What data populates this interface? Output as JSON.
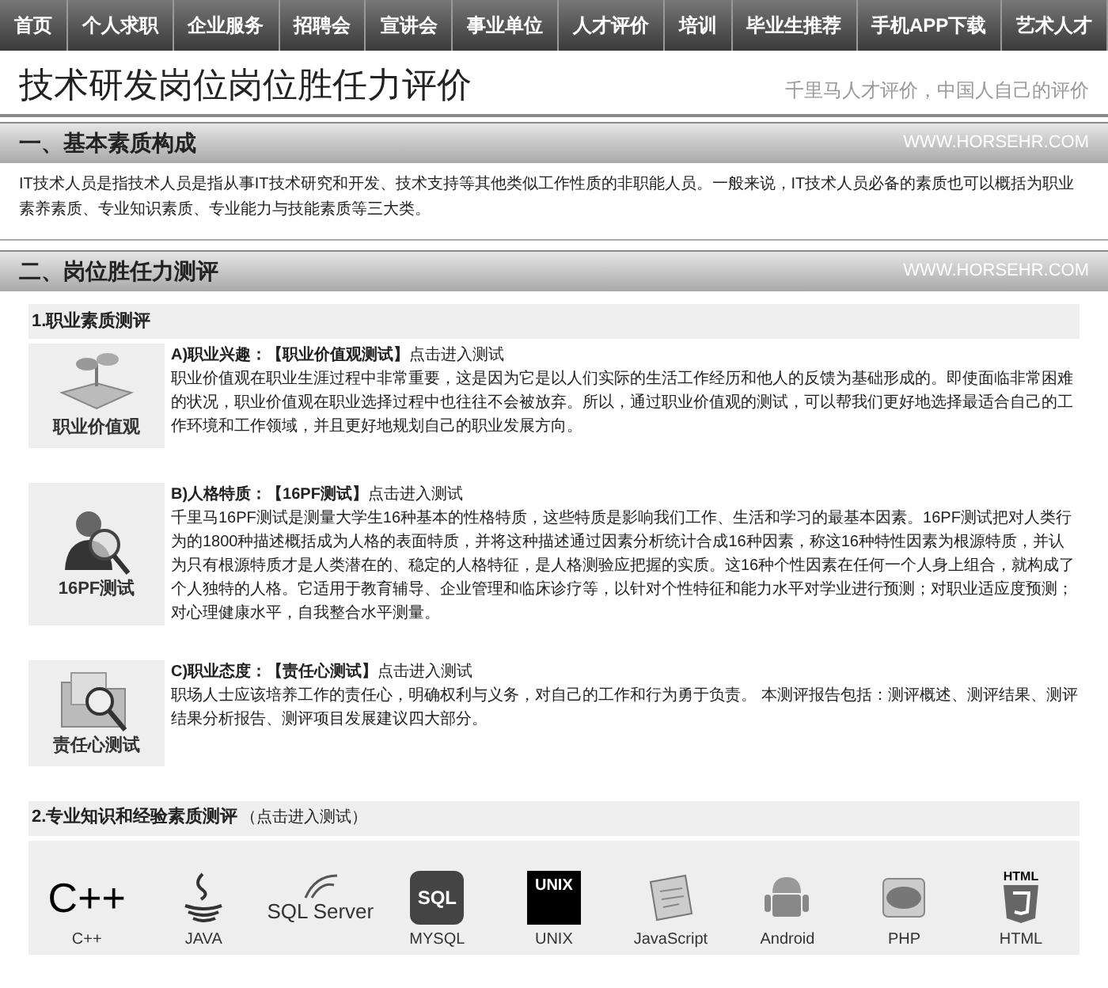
{
  "nav": [
    "首页",
    "个人求职",
    "企业服务",
    "招聘会",
    "宣讲会",
    "事业单位",
    "人才评价",
    "培训",
    "毕业生推荐",
    "手机APP下载",
    "艺术人才"
  ],
  "header": {
    "title": "技术研发岗位岗位胜任力评价",
    "slogan": "千里马人才评价，中国人自己的评价"
  },
  "sections": [
    {
      "title": "一、基本素质构成",
      "site": "WWW.HORSEHR.COM",
      "paragraph": "IT技术人员是指技术人员是指从事IT技术研究和开发、技术支持等其他类似工作性质的非职能人员。一般来说，IT技术人员必备的素质也可以概括为职业素养素质、专业知识素质、专业能力与技能素质等三大类。"
    },
    {
      "title": "二、岗位胜任力测评",
      "site": "WWW.HORSEHR.COM",
      "subsections": [
        {
          "title": "1.职业素质测评",
          "tests": [
            {
              "kind": "plant",
              "caption": "职业价值观",
              "heading": "**A)职业兴趣：【职业价值观测试】**点击进入测试",
              "text": "职业价值观在职业生涯过程中非常重要，这是因为它是以人们实际的生活工作经历和他人的反馈为基础形成的。即使面临非常困难的状况，职业价值观在职业选择过程中也往往不会被放弃。所以，通过职业价值观的测试，可以帮我们更好地选择最适合自己的工作环境和工作领域，并且更好地规划自己的职业发展方向。"
            },
            {
              "kind": "person",
              "caption": "16PF测试",
              "heading": "**B)人格特质：【16PF测试】**点击进入测试",
              "text": "千里马16PF测试是测量大学生16种基本的性格特质，这些特质是影响我们工作、生活和学习的最基本因素。16PF测试把对人类行为的1800种描述概括成为人格的表面特质，并将这种描述通过因素分析统计合成16种因素，称这16种特性因素为根源特质，并认为只有根源特质才是人类潜在的、稳定的人格特征，是人格测验应把握的实质。这16种个性因素在任何一个人身上组合，就构成了个人独特的人格。它适用于教育辅导、企业管理和临床诊疗等，以针对个性特征和能力水平对学业进行预测；对职业适应度预测；对心理健康水平，自我整合水平测量。"
            },
            {
              "kind": "folder",
              "caption": "责任心测试",
              "heading": "**C)职业态度：【责任心测试】**点击进入测试",
              "text": "职场人士应该培养工作的责任心，明确权利与义务，对自己的工作和行为勇于负责。 本测评报告包括：测评概述、测评结果、测评结果分析报告、测评项目发展建议四大部分。"
            }
          ]
        },
        {
          "title": "2.专业知识和经验素质测评",
          "note": "（点击进入测试）",
          "logos": [
            {
              "kind": "cpp",
              "logo_text": "C++",
              "label": "C++"
            },
            {
              "kind": "java",
              "label": "JAVA"
            },
            {
              "kind": "sqlserver",
              "logo_text": "SQL Server"
            },
            {
              "kind": "mysql",
              "logo_text": "SQL",
              "label": "MYSQL"
            },
            {
              "kind": "unix",
              "logo_text": "UNIX",
              "label": "UNIX"
            },
            {
              "kind": "javascript",
              "label": "JavaScript"
            },
            {
              "kind": "android",
              "label": "Android"
            },
            {
              "kind": "php",
              "label": "PHP"
            },
            {
              "kind": "html",
              "logo_text": "HTML",
              "label": "HTML"
            }
          ]
        }
      ]
    }
  ]
}
